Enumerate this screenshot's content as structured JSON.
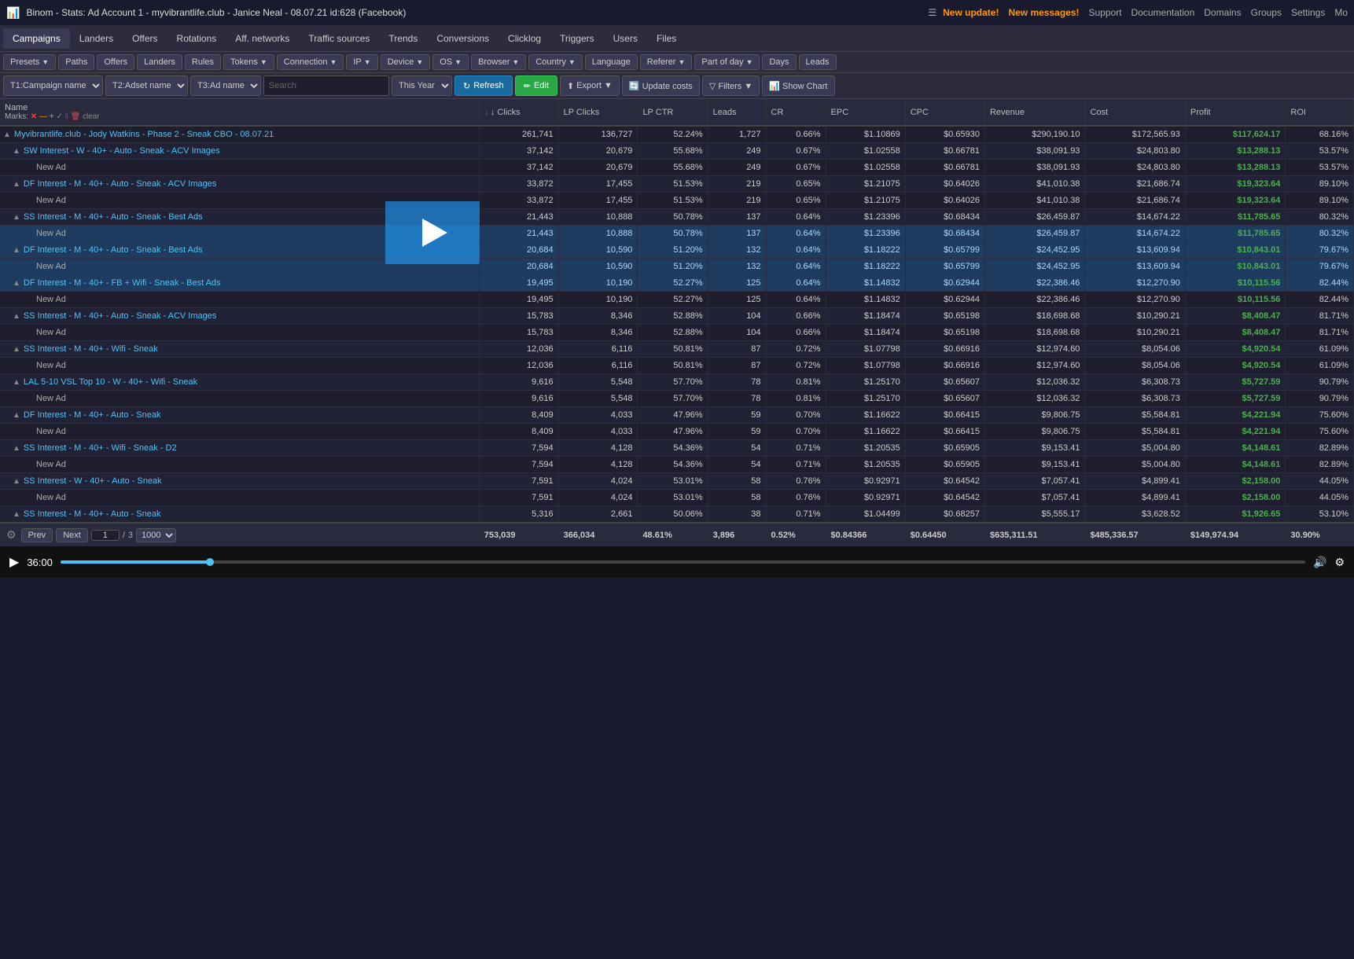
{
  "topBar": {
    "title": "Binom - Stats: Ad Account 1 - myvibrantlife.club - Janice Neal - 08.07.21 id:628 (Facebook)",
    "newUpdate": "New update!",
    "newMessages": "New messages!",
    "links": [
      "Support",
      "Documentation",
      "Domains",
      "Groups",
      "Settings",
      "Mo"
    ]
  },
  "mainNav": {
    "items": [
      "Campaigns",
      "Landers",
      "Offers",
      "Rotations",
      "Aff. networks",
      "Traffic sources",
      "Trends",
      "Conversions",
      "Clicklog",
      "Triggers",
      "Users",
      "Files"
    ]
  },
  "toolbar": {
    "presets": "Presets",
    "paths": "Paths",
    "offers": "Offers",
    "landers": "Landers",
    "rules": "Rules",
    "tokens": "Tokens",
    "connection": "Connection",
    "ip": "IP",
    "device": "Device",
    "os": "OS",
    "browser": "Browser",
    "country": "Country",
    "language": "Language",
    "referer": "Referer",
    "partOfDay": "Part of day",
    "days": "Days",
    "leads": "Leads"
  },
  "filterRow": {
    "t1": "T1:Campaign name",
    "t2": "T2:Adset name",
    "t3": "T3:Ad name",
    "searchPlaceholder": "Search",
    "timeRange": "This Year",
    "refreshLabel": "Refresh",
    "editLabel": "Edit",
    "exportLabel": "Export",
    "updateCostsLabel": "Update costs",
    "filtersLabel": "Filters",
    "showChartLabel": "Show Chart"
  },
  "table": {
    "headers": [
      "Name",
      "Marks",
      "↓ Clicks",
      "LP Clicks",
      "LP CTR",
      "Leads",
      "CR",
      "EPC",
      "CPC",
      "Revenue",
      "Cost",
      "Profit",
      "ROI"
    ],
    "marksText": "✕ — + ✓ ‖ 🗑 clear",
    "rows": [
      {
        "level": 0,
        "expand": true,
        "name": "Myvibrantlife.club - Jody Watkins - Phase 2 - Sneak CBO - 08.07.21",
        "clicks": "261,741",
        "lpClicks": "136,727",
        "lpCtr": "52.24%",
        "leads": "1,727",
        "cr": "0.66%",
        "epc": "$1.10869",
        "cpc": "$0.65930",
        "revenue": "$290,190.10",
        "cost": "$172,565.93",
        "profit": "$117,624.17",
        "roi": "68.16%",
        "profitClass": "profit-green"
      },
      {
        "level": 1,
        "expand": true,
        "name": "SW Interest - W - 40+ - Auto - Sneak - ACV Images",
        "clicks": "37,142",
        "lpClicks": "20,679",
        "lpCtr": "55.68%",
        "leads": "249",
        "cr": "0.67%",
        "epc": "$1.02558",
        "cpc": "$0.66781",
        "revenue": "$38,091.93",
        "cost": "$24,803.80",
        "profit": "$13,288.13",
        "roi": "53.57%",
        "profitClass": "profit-green"
      },
      {
        "level": 2,
        "expand": false,
        "name": "New Ad",
        "clicks": "37,142",
        "lpClicks": "20,679",
        "lpCtr": "55.68%",
        "leads": "249",
        "cr": "0.67%",
        "epc": "$1.02558",
        "cpc": "$0.66781",
        "revenue": "$38,091.93",
        "cost": "$24,803.80",
        "profit": "$13,288.13",
        "roi": "53.57%",
        "profitClass": "profit-green"
      },
      {
        "level": 1,
        "expand": true,
        "name": "DF Interest - M - 40+ - Auto - Sneak - ACV Images",
        "clicks": "33,872",
        "lpClicks": "17,455",
        "lpCtr": "51.53%",
        "leads": "219",
        "cr": "0.65%",
        "epc": "$1.21075",
        "cpc": "$0.64026",
        "revenue": "$41,010.38",
        "cost": "$21,686.74",
        "profit": "$19,323.64",
        "roi": "89.10%",
        "profitClass": "profit-green"
      },
      {
        "level": 2,
        "expand": false,
        "name": "New Ad",
        "clicks": "33,872",
        "lpClicks": "17,455",
        "lpCtr": "51.53%",
        "leads": "219",
        "cr": "0.65%",
        "epc": "$1.21075",
        "cpc": "$0.64026",
        "revenue": "$41,010.38",
        "cost": "$21,686.74",
        "profit": "$19,323.64",
        "roi": "89.10%",
        "profitClass": "profit-green"
      },
      {
        "level": 1,
        "expand": true,
        "name": "SS Interest - M - 40+ - Auto - Sneak - Best Ads",
        "clicks": "21,443",
        "lpClicks": "10,888",
        "lpCtr": "50.78%",
        "leads": "137",
        "cr": "0.64%",
        "epc": "$1.23396",
        "cpc": "$0.68434",
        "revenue": "$26,459.87",
        "cost": "$14,674.22",
        "profit": "$11,785.65",
        "roi": "80.32%",
        "profitClass": "profit-green",
        "highlight": false
      },
      {
        "level": 2,
        "expand": false,
        "name": "New Ad",
        "clicks": "21,443",
        "lpClicks": "10,888",
        "lpCtr": "50.78%",
        "leads": "137",
        "cr": "0.64%",
        "epc": "$1.23396",
        "cpc": "$0.68434",
        "revenue": "$26,459.87",
        "cost": "$14,674.22",
        "profit": "$11,785.65",
        "roi": "80.32%",
        "profitClass": "profit-green",
        "highlight": true,
        "videoOverlay": true
      },
      {
        "level": 1,
        "expand": true,
        "name": "DF Interest - M - 40+ - Auto - Sneak - Best Ads",
        "clicks": "20,684",
        "lpClicks": "10,590",
        "lpCtr": "51.20%",
        "leads": "132",
        "cr": "0.64%",
        "epc": "$1.18222",
        "cpc": "$0.65799",
        "revenue": "$24,452.95",
        "cost": "$13,609.94",
        "profit": "$10,843.01",
        "roi": "79.67%",
        "profitClass": "profit-green",
        "highlight": true,
        "videoOverlay": true
      },
      {
        "level": 2,
        "expand": false,
        "name": "New Ad",
        "clicks": "20,684",
        "lpClicks": "10,590",
        "lpCtr": "51.20%",
        "leads": "132",
        "cr": "0.64%",
        "epc": "$1.18222",
        "cpc": "$0.65799",
        "revenue": "$24,452.95",
        "cost": "$13,609.94",
        "profit": "$10,843.01",
        "roi": "79.67%",
        "profitClass": "profit-green",
        "highlight": true
      },
      {
        "level": 1,
        "expand": true,
        "name": "DF Interest - M - 40+ - FB + Wifi - Sneak - Best Ads",
        "clicks": "19,495",
        "lpClicks": "10,190",
        "lpCtr": "52.27%",
        "leads": "125",
        "cr": "0.64%",
        "epc": "$1.14832",
        "cpc": "$0.62944",
        "revenue": "$22,386.46",
        "cost": "$12,270.90",
        "profit": "$10,115.56",
        "roi": "82.44%",
        "profitClass": "profit-green",
        "highlight": true
      },
      {
        "level": 2,
        "expand": false,
        "name": "New Ad",
        "clicks": "19,495",
        "lpClicks": "10,190",
        "lpCtr": "52.27%",
        "leads": "125",
        "cr": "0.64%",
        "epc": "$1.14832",
        "cpc": "$0.62944",
        "revenue": "$22,386.46",
        "cost": "$12,270.90",
        "profit": "$10,115.56",
        "roi": "82.44%",
        "profitClass": "profit-green"
      },
      {
        "level": 1,
        "expand": true,
        "name": "SS Interest - M - 40+ - Auto - Sneak - ACV Images",
        "clicks": "15,783",
        "lpClicks": "8,346",
        "lpCtr": "52.88%",
        "leads": "104",
        "cr": "0.66%",
        "epc": "$1.18474",
        "cpc": "$0.65198",
        "revenue": "$18,698.68",
        "cost": "$10,290.21",
        "profit": "$8,408.47",
        "roi": "81.71%",
        "profitClass": "profit-green"
      },
      {
        "level": 2,
        "expand": false,
        "name": "New Ad",
        "clicks": "15,783",
        "lpClicks": "8,346",
        "lpCtr": "52.88%",
        "leads": "104",
        "cr": "0.66%",
        "epc": "$1.18474",
        "cpc": "$0.65198",
        "revenue": "$18,698.68",
        "cost": "$10,290.21",
        "profit": "$8,408.47",
        "roi": "81.71%",
        "profitClass": "profit-green"
      },
      {
        "level": 1,
        "expand": true,
        "name": "SS Interest - M - 40+ - Wifi - Sneak",
        "clicks": "12,036",
        "lpClicks": "6,116",
        "lpCtr": "50.81%",
        "leads": "87",
        "cr": "0.72%",
        "epc": "$1.07798",
        "cpc": "$0.66916",
        "revenue": "$12,974.60",
        "cost": "$8,054.06",
        "profit": "$4,920.54",
        "roi": "61.09%",
        "profitClass": "profit-green"
      },
      {
        "level": 2,
        "expand": false,
        "name": "New Ad",
        "clicks": "12,036",
        "lpClicks": "6,116",
        "lpCtr": "50.81%",
        "leads": "87",
        "cr": "0.72%",
        "epc": "$1.07798",
        "cpc": "$0.66916",
        "revenue": "$12,974.60",
        "cost": "$8,054.06",
        "profit": "$4,920.54",
        "roi": "61.09%",
        "profitClass": "profit-green"
      },
      {
        "level": 1,
        "expand": true,
        "name": "LAL 5-10 VSL Top 10 - W - 40+ - Wifi - Sneak",
        "clicks": "9,616",
        "lpClicks": "5,548",
        "lpCtr": "57.70%",
        "leads": "78",
        "cr": "0.81%",
        "epc": "$1.25170",
        "cpc": "$0.65607",
        "revenue": "$12,036.32",
        "cost": "$6,308.73",
        "profit": "$5,727.59",
        "roi": "90.79%",
        "profitClass": "profit-green"
      },
      {
        "level": 2,
        "expand": false,
        "name": "New Ad",
        "clicks": "9,616",
        "lpClicks": "5,548",
        "lpCtr": "57.70%",
        "leads": "78",
        "cr": "0.81%",
        "epc": "$1.25170",
        "cpc": "$0.65607",
        "revenue": "$12,036.32",
        "cost": "$6,308.73",
        "profit": "$5,727.59",
        "roi": "90.79%",
        "profitClass": "profit-green"
      },
      {
        "level": 1,
        "expand": true,
        "name": "DF Interest - M - 40+ - Auto - Sneak",
        "clicks": "8,409",
        "lpClicks": "4,033",
        "lpCtr": "47.96%",
        "leads": "59",
        "cr": "0.70%",
        "epc": "$1.16622",
        "cpc": "$0.66415",
        "revenue": "$9,806.75",
        "cost": "$5,584.81",
        "profit": "$4,221.94",
        "roi": "75.60%",
        "profitClass": "profit-green"
      },
      {
        "level": 2,
        "expand": false,
        "name": "New Ad",
        "clicks": "8,409",
        "lpClicks": "4,033",
        "lpCtr": "47.96%",
        "leads": "59",
        "cr": "0.70%",
        "epc": "$1.16622",
        "cpc": "$0.66415",
        "revenue": "$9,806.75",
        "cost": "$5,584.81",
        "profit": "$4,221.94",
        "roi": "75.60%",
        "profitClass": "profit-green"
      },
      {
        "level": 1,
        "expand": true,
        "name": "SS Interest - M - 40+ - Wifi - Sneak - D2",
        "clicks": "7,594",
        "lpClicks": "4,128",
        "lpCtr": "54.36%",
        "leads": "54",
        "cr": "0.71%",
        "epc": "$1.20535",
        "cpc": "$0.65905",
        "revenue": "$9,153.41",
        "cost": "$5,004.80",
        "profit": "$4,148.61",
        "roi": "82.89%",
        "profitClass": "profit-green"
      },
      {
        "level": 2,
        "expand": false,
        "name": "New Ad",
        "clicks": "7,594",
        "lpClicks": "4,128",
        "lpCtr": "54.36%",
        "leads": "54",
        "cr": "0.71%",
        "epc": "$1.20535",
        "cpc": "$0.65905",
        "revenue": "$9,153.41",
        "cost": "$5,004.80",
        "profit": "$4,148.61",
        "roi": "82.89%",
        "profitClass": "profit-green"
      },
      {
        "level": 1,
        "expand": true,
        "name": "SS Interest - W - 40+ - Auto - Sneak",
        "clicks": "7,591",
        "lpClicks": "4,024",
        "lpCtr": "53.01%",
        "leads": "58",
        "cr": "0.76%",
        "epc": "$0.92971",
        "cpc": "$0.64542",
        "revenue": "$7,057.41",
        "cost": "$4,899.41",
        "profit": "$2,158.00",
        "roi": "44.05%",
        "profitClass": "profit-green"
      },
      {
        "level": 2,
        "expand": false,
        "name": "New Ad",
        "clicks": "7,591",
        "lpClicks": "4,024",
        "lpCtr": "53.01%",
        "leads": "58",
        "cr": "0.76%",
        "epc": "$0.92971",
        "cpc": "$0.64542",
        "revenue": "$7,057.41",
        "cost": "$4,899.41",
        "profit": "$2,158.00",
        "roi": "44.05%",
        "profitClass": "profit-green"
      },
      {
        "level": 1,
        "expand": true,
        "name": "SS Interest - M - 40+ - Auto - Sneak",
        "clicks": "5,316",
        "lpClicks": "2,661",
        "lpCtr": "50.06%",
        "leads": "38",
        "cr": "0.71%",
        "epc": "$1.04499",
        "cpc": "$0.68257",
        "revenue": "$5,555.17",
        "cost": "$3,628.52",
        "profit": "$1,926.65",
        "roi": "53.10%",
        "profitClass": "profit-green"
      }
    ],
    "footer": {
      "clicks": "753,039",
      "lpClicks": "366,034",
      "lpCtr": "48.61%",
      "leads": "3,896",
      "cr": "0.52%",
      "epc": "$0.84366",
      "cpc": "$0.64450",
      "revenue": "$635,311.51",
      "cost": "$485,336.57",
      "profit": "$149,974.94",
      "roi": "30.90%"
    }
  },
  "pagination": {
    "prevLabel": "Prev",
    "nextLabel": "Next",
    "currentPage": "1",
    "totalPages": "3",
    "perPageOptions": [
      "1000"
    ],
    "perPage": "1000"
  },
  "videoBar": {
    "time": "36:00",
    "progressPct": 12
  }
}
